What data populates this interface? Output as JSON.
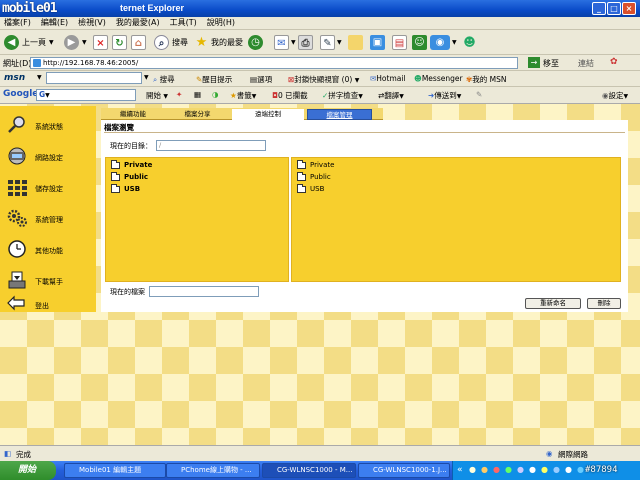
{
  "window": {
    "logo_text": "mobile01",
    "title": "ternet Explorer",
    "minimize": "_",
    "maximize": "□",
    "close": "×"
  },
  "menu": [
    "檔案(F)",
    "編輯(E)",
    "檢視(V)",
    "我的最愛(A)",
    "工具(T)",
    "說明(H)"
  ],
  "toolbar": {
    "back": "上一頁",
    "search": "搜尋",
    "favorites": "我的最愛"
  },
  "address": {
    "label": "網址(D)",
    "url": "http://192.168.78.46:2005/",
    "go": "移至",
    "links": "連結"
  },
  "msn": {
    "brand": "msn",
    "search": "搜尋",
    "highlight": "醒目提示",
    "options": "選項",
    "popup_blocker": "封鎖快顯視窗 (0)",
    "hotmail": "Hotmail",
    "messenger": "Messenger",
    "my_msn": "我的 MSN"
  },
  "google": {
    "brand": "Google",
    "prefix": "G",
    "start": "開始",
    "bookmarks": "書籤",
    "blocked": "0 已攔截",
    "spellcheck": "拼字檢查",
    "translate": "翻譯",
    "send_to": "傳送到",
    "settings": "設定"
  },
  "sidebar": [
    {
      "label": "系統狀態",
      "icon": "magnifier-icon"
    },
    {
      "label": "網路設定",
      "icon": "network-icon"
    },
    {
      "label": "儲存設定",
      "icon": "storage-icon"
    },
    {
      "label": "系統管理",
      "icon": "gears-icon"
    },
    {
      "label": "其他功能",
      "icon": "clock-icon"
    },
    {
      "label": "下載幫手",
      "icon": "download-icon"
    },
    {
      "label": "登出",
      "icon": "logout-icon"
    }
  ],
  "tabs": [
    "繼續功能",
    "檔案分享",
    "遠端控制",
    "檔案管理"
  ],
  "panel": {
    "title": "檔案瀏覽",
    "current_dir_label": "現在的目錄：",
    "current_dir_value": "/",
    "current_file_label": "現在的檔案",
    "rename_button": "重新命名",
    "delete_button": "刪除"
  },
  "left_folders": [
    "Private",
    "Public",
    "USB"
  ],
  "right_folders": [
    "Private",
    "Public",
    "USB"
  ],
  "status": {
    "text": "完成",
    "zone": "網際網路"
  },
  "taskbar": {
    "start": "開始",
    "tasks": [
      "Mobile01 編輯主題",
      "PChome線上購物 - ...",
      "CG-WLNSC1000 - M...",
      "CG-WLNSC1000-1.J..."
    ],
    "watermark": "#87894"
  },
  "colors": {
    "sidebar": "#f7cf2d",
    "tab_active": "#3a6fd3",
    "titlebar": "#0a4bc8"
  }
}
